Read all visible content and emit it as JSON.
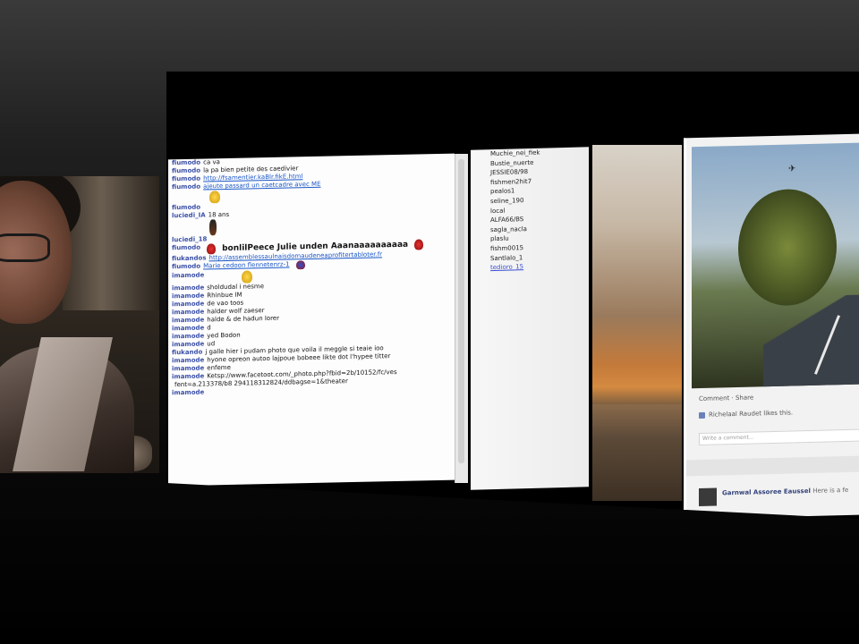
{
  "chat": {
    "messages": [
      {
        "nick": "fiumodo",
        "text": "ca va"
      },
      {
        "nick": "fiumodo",
        "text": "la pa bien petite des caedivier"
      },
      {
        "nick": "fiumodo",
        "text": "http://fsamentier.kaBlr.fikE.html",
        "link": true
      },
      {
        "nick": "fiumodo",
        "text": "ajeute passard un caetcadre avec ME",
        "link": true
      },
      {
        "nick": "",
        "text": "",
        "emoji": "thumbs-up"
      },
      {
        "nick": "fiumodo",
        "text": ""
      },
      {
        "nick": "luciedi_IA",
        "text": "18 ans"
      },
      {
        "nick": "",
        "text": "",
        "emoji": "guitar"
      },
      {
        "nick": "luciedi_18",
        "text": ""
      },
      {
        "nick": "fiumodo",
        "text": "bonlilPeece Julie unden Aaanaaaaaaaaaa",
        "big": true,
        "emoji": "rose"
      },
      {
        "nick": "fiukandos",
        "text": "http://assemblessaulnaisdomaudeneaprofitertabloter.fr",
        "link": true
      },
      {
        "nick": "",
        "text": ""
      },
      {
        "nick": "fiumodo",
        "text": "Marie cedoon flennetenrz-1",
        "link": true,
        "emoji": "pin"
      },
      {
        "nick": "imamode",
        "text": "",
        "emoji": "thumbs-up"
      },
      {
        "nick": "imamode",
        "text": "sholdudal i nesme"
      },
      {
        "nick": "imamode",
        "text": "Rhinbue IM"
      },
      {
        "nick": "imamode",
        "text": "de vao toos"
      },
      {
        "nick": "imamode",
        "text": "halder wolf zaeser"
      },
      {
        "nick": "imamode",
        "text": "halde & de hadun lorer"
      },
      {
        "nick": "imamode",
        "text": "d"
      },
      {
        "nick": "imamode",
        "text": "yed Bodon"
      },
      {
        "nick": "imamode",
        "text": "ud"
      },
      {
        "nick": "fiukando",
        "text": "j galle hier i pudam photo que voila il meggle si teaie ioo"
      },
      {
        "nick": "imamode",
        "text": "hyone opreon autoo lajpoue bobeee likte dot l'hypee titter"
      },
      {
        "nick": "imamode",
        "text": "enfeme"
      },
      {
        "nick": "imamode",
        "text": "Ketsp://www.facetoot.com/_photo.php?fbid=2b/10152/fc/ves"
      },
      {
        "nick": "",
        "text": "fent=a.213378/b8 294118312824/ddbagse=1&theater"
      },
      {
        "nick": "imamode",
        "text": ""
      }
    ]
  },
  "users": {
    "items": [
      {
        "name": "Muchie_nei_fiek",
        "selected": false
      },
      {
        "name": "Bustie_nuerte",
        "selected": false
      },
      {
        "name": "JESSIE08/98",
        "selected": false
      },
      {
        "name": "fishmen2hit7",
        "selected": false
      },
      {
        "name": "pealos1",
        "selected": false
      },
      {
        "name": "seline_190",
        "selected": false
      },
      {
        "name": "local",
        "selected": false
      },
      {
        "name": "ALFA66/BS",
        "selected": false
      },
      {
        "name": "sagla_nacla",
        "selected": false
      },
      {
        "name": "plaslu",
        "selected": false
      },
      {
        "name": "fishm0015",
        "selected": false
      },
      {
        "name": "Santlalo_1",
        "selected": false
      },
      {
        "name": "tedioro_15",
        "selected": true
      }
    ]
  },
  "post": {
    "actions": "Comment · Share",
    "likes": "Richelaal Raudet likes this.",
    "comment_placeholder": "Write a comment...",
    "author": "Garnwal Assoree Eaussel",
    "author_suffix": "Here is a fe"
  }
}
